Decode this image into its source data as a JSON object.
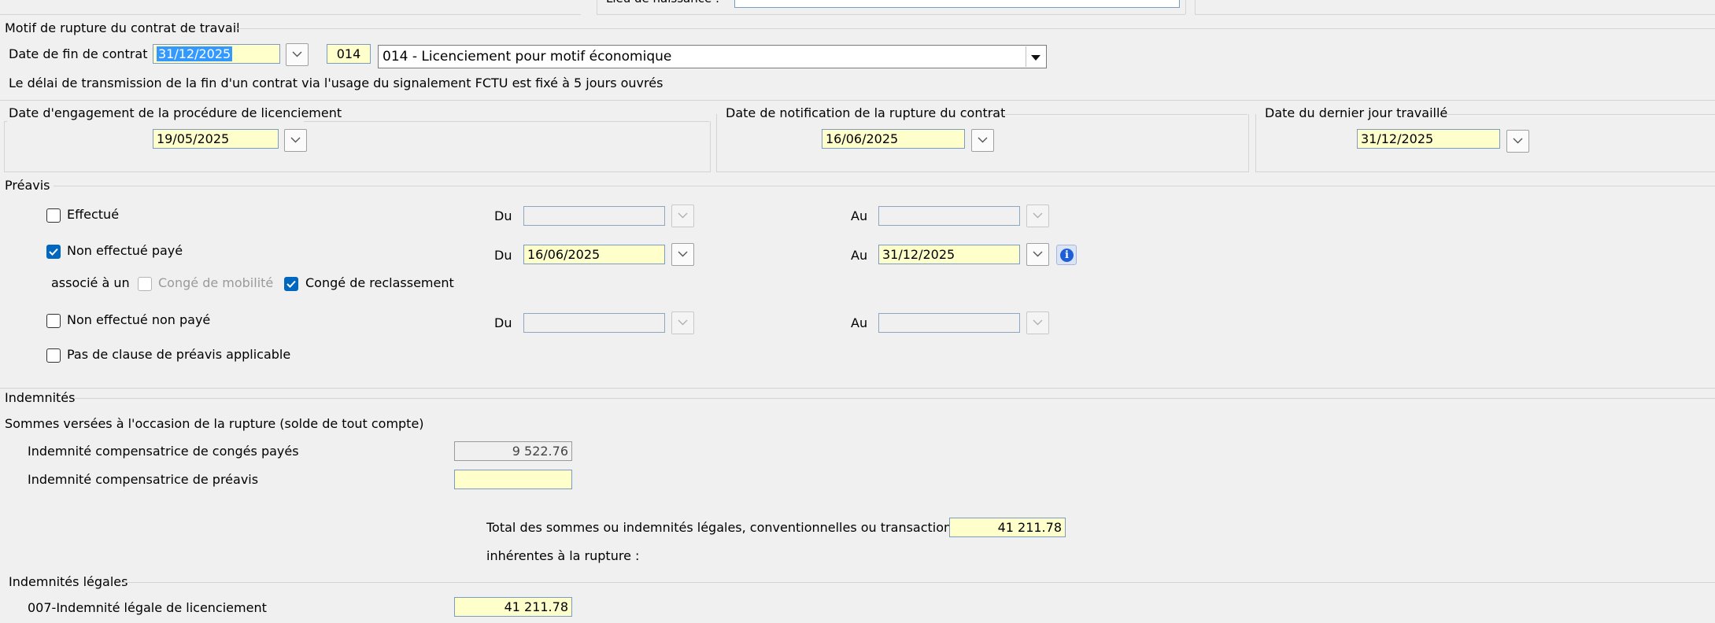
{
  "top": {
    "lieu_naissance_label": "Lieu de naissance :"
  },
  "motif": {
    "section_title": "Motif de rupture du contrat de travail",
    "date_fin_label": "Date de fin de contrat :",
    "date_fin_value": "31/12/2025",
    "motif_code": "014",
    "motif_selected": "014 - Licenciement pour motif économique",
    "info_text": "Le délai de transmission de la fin d'un contrat via l'usage du signalement FCTU est fixé à 5 jours ouvrés"
  },
  "dates": {
    "engagement_title": "Date d'engagement de la procédure de licenciement",
    "engagement_value": "19/05/2025",
    "notification_title": "Date de notification de la rupture du contrat",
    "notification_value": "16/06/2025",
    "dernier_jour_title": "Date du dernier jour travaillé",
    "dernier_jour_value": "31/12/2025"
  },
  "preavis": {
    "section_title": "Préavis",
    "du_label": "Du",
    "au_label": "Au",
    "effectue_label": "Effectué",
    "non_effectue_paye_label": "Non effectué payé",
    "non_effectue_paye_du": "16/06/2025",
    "non_effectue_paye_au": "31/12/2025",
    "associe_label": "associé à un",
    "conge_mobilite_label": "Congé de mobilité",
    "conge_reclassement_label": "Congé de reclassement",
    "non_effectue_non_paye_label": "Non effectué non payé",
    "pas_clause_label": "Pas de clause de préavis applicable",
    "info_icon_glyph": "i"
  },
  "indemnites": {
    "section_title": "Indemnités",
    "sommes_label": "Sommes versées à l'occasion de la rupture (solde de tout compte)",
    "conges_payes_label": "Indemnité compensatrice de congés payés",
    "conges_payes_value": "9 522.76",
    "preavis_label": "Indemnité compensatrice de préavis",
    "preavis_value": "",
    "total_label_line1": "Total des sommes ou indemnités légales, conventionnelles ou transactionnelles",
    "total_label_line2": "inhérentes à la rupture :",
    "total_value": "41 211.78"
  },
  "legales": {
    "section_title": "Indemnités légales",
    "item_label": "007-Indemnité légale de licenciement",
    "item_value": "41 211.78"
  },
  "colors": {
    "field_yellow": "#ffffcc",
    "checkbox_blue": "#0067c0",
    "selection_blue": "#3399ff"
  }
}
